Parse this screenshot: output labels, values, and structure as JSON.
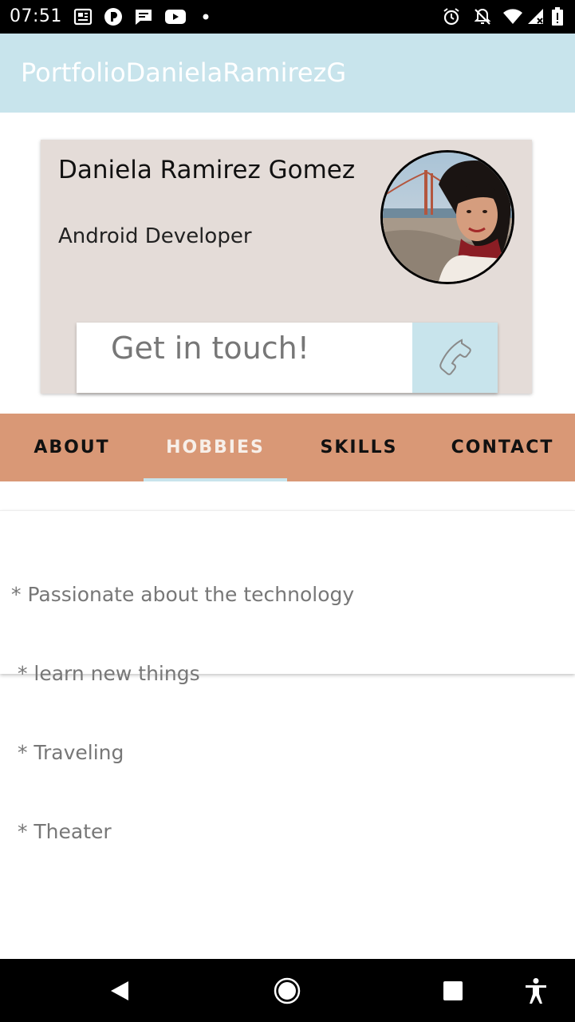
{
  "status_bar": {
    "time": "07:51",
    "icons_left": [
      "news-icon",
      "pocket-icon",
      "chat-icon",
      "youtube-icon",
      "dot-icon"
    ],
    "icons_right": [
      "alarm-icon",
      "notifications-off-icon",
      "wifi-icon",
      "signal-icon",
      "battery-icon"
    ]
  },
  "app_bar": {
    "title": "PortfolioDanielaRamirezG"
  },
  "profile": {
    "name": "Daniela Ramirez Gomez",
    "role": "Android Developer",
    "avatar_icon": "profile-photo",
    "contact_label": "Get in touch!",
    "contact_icon": "phone-icon"
  },
  "tabs": [
    {
      "label": "ABOUT",
      "active": false
    },
    {
      "label": "HOBBIES",
      "active": true
    },
    {
      "label": "SKILLS",
      "active": false
    },
    {
      "label": "CONTACT",
      "active": false
    }
  ],
  "content": {
    "lines": [
      "* Passionate about the technology",
      " * learn new things",
      " * Traveling",
      " * Theater"
    ]
  },
  "nav_bar": {
    "buttons": [
      "back-icon",
      "home-icon",
      "recents-icon",
      "accessibility-icon"
    ]
  },
  "colors": {
    "app_bar": "#c8e4ec",
    "card": "#e4dcd8",
    "tab_bar": "#d99876",
    "indicator": "#c8e4ec"
  }
}
